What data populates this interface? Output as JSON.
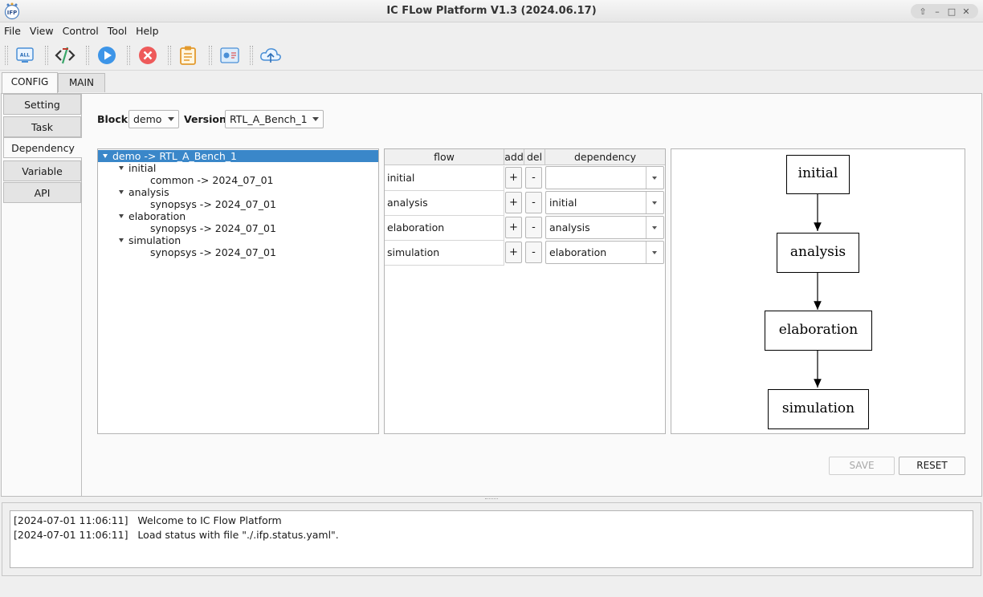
{
  "window": {
    "title": "IC FLow Platform V1.3 (2024.06.17)",
    "controls": [
      "⇧",
      "–",
      "□",
      "✕"
    ]
  },
  "menu": [
    "File",
    "View",
    "Control",
    "Tool",
    "Help"
  ],
  "toolbar": [
    "all-icon",
    "code-icon",
    "play-icon",
    "stop-icon",
    "clipboard-icon",
    "dashboard-icon",
    "cloud-upload-icon"
  ],
  "top_tabs": [
    "CONFIG",
    "MAIN"
  ],
  "side_tabs": [
    "Setting",
    "Task",
    "Dependency",
    "Variable",
    "API"
  ],
  "block": {
    "label": "Block",
    "value": "demo"
  },
  "version": {
    "label": "Version",
    "value": "RTL_A_Bench_1"
  },
  "tree": {
    "root": "demo -> RTL_A_Bench_1",
    "items": [
      {
        "name": "initial",
        "child": "common -> 2024_07_01"
      },
      {
        "name": "analysis",
        "child": "synopsys -> 2024_07_01"
      },
      {
        "name": "elaboration",
        "child": "synopsys -> 2024_07_01"
      },
      {
        "name": "simulation",
        "child": "synopsys -> 2024_07_01"
      }
    ]
  },
  "table": {
    "headers": [
      "flow",
      "add",
      "del",
      "dependency"
    ],
    "rows": [
      {
        "flow": "initial",
        "add": "+",
        "del": "-",
        "dependency": ""
      },
      {
        "flow": "analysis",
        "add": "+",
        "del": "-",
        "dependency": "initial"
      },
      {
        "flow": "elaboration",
        "add": "+",
        "del": "-",
        "dependency": "analysis"
      },
      {
        "flow": "simulation",
        "add": "+",
        "del": "-",
        "dependency": "elaboration"
      }
    ]
  },
  "graph": {
    "nodes": [
      "initial",
      "analysis",
      "elaboration",
      "simulation"
    ]
  },
  "buttons": {
    "save": "SAVE",
    "reset": "RESET"
  },
  "log": [
    "[2024-07-01 11:06:11]   Welcome to IC Flow Platform",
    "[2024-07-01 11:06:11]   Load status with file \"./.ifp.status.yaml\"."
  ],
  "colors": {
    "selection": "#3a87c9",
    "accent": "#2d8fe0",
    "stop": "#e74c4c"
  }
}
